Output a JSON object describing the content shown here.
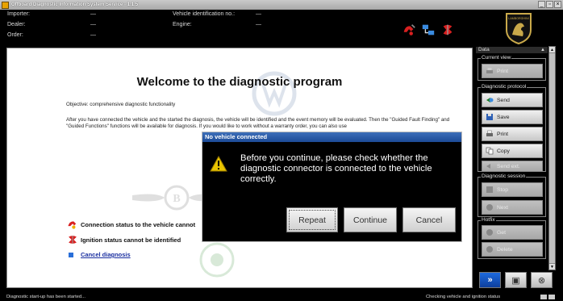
{
  "window": {
    "title": "Offboard Diagnostic Information System Service - 1.1.5"
  },
  "header": {
    "importer_label": "Importer:",
    "importer_value": "—",
    "dealer_label": "Dealer:",
    "dealer_value": "—",
    "order_label": "Order:",
    "order_value": "—",
    "vin_label": "Vehicle identification no.:",
    "vin_value": "—",
    "engine_label": "Engine:",
    "engine_value": "—",
    "logo_text": "LAMBORGHINI"
  },
  "main": {
    "heading": "Welcome to the diagnostic program",
    "objective": "Objective: comprehensive diagnostic functionality",
    "description": "After you have connected the vehicle and the started the diagnosis, the vehicle will be identified and the event memory will be evaluated. Then the \"Guided Fault Finding\" and \"Guided Functions\" functions will be available for diagnosis. If you would like to work without a warranty order, you can also use",
    "status_connection": "Connection status to the vehicle cannot",
    "status_ignition": "Ignition status cannot be identified",
    "cancel_link": "Cancel diagnosis"
  },
  "dialog": {
    "title": "No vehicle connected",
    "message": "Before you continue, please check whether the diagnostic connector is connected to the vehicle correctly.",
    "repeat": "Repeat",
    "continue": "Continue",
    "cancel": "Cancel"
  },
  "side": {
    "header": "Data",
    "current_view": "Current view",
    "print_view": "Print",
    "diag_protocol": "Diagnostic protocol",
    "send": "Send",
    "save": "Save",
    "print": "Print",
    "copy": "Copy",
    "send_ext": "Send ext.",
    "diag_session": "Diagnostic session",
    "stop": "Stop",
    "next": "Next",
    "hotfix": "Hotfix",
    "get": "Get",
    "delete": "Delete"
  },
  "status": {
    "left": "Diagnostic start-up has been started...",
    "right": "Checking vehicle and ignition status"
  },
  "colors": {
    "accent": "#1d6adf",
    "dialog_title": "#1c4a96",
    "warning": "#e8c400",
    "error_red": "#d92020"
  }
}
